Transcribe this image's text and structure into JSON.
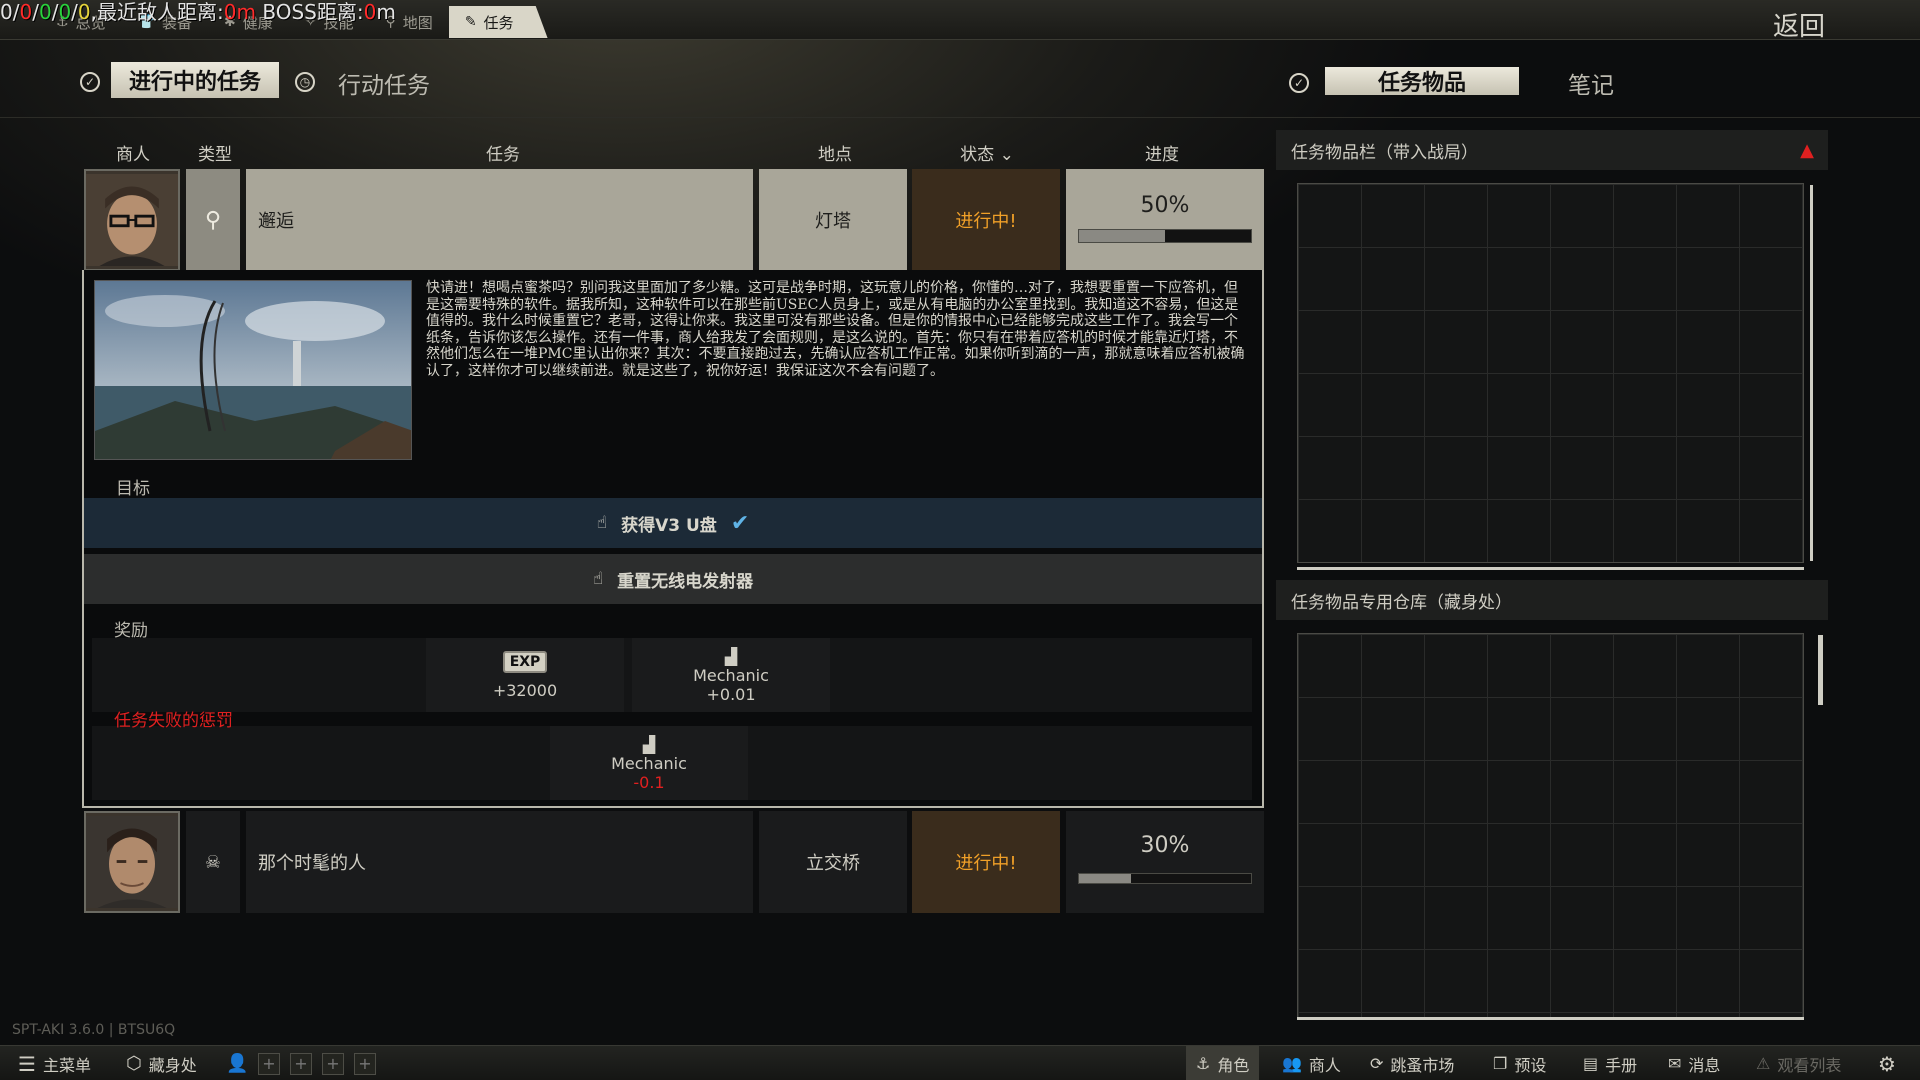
{
  "overlay": {
    "prefix": "0/",
    "n1": "0",
    "sep1": "/",
    "n2": "0",
    "sep2": "/",
    "n3": "0",
    "sep3": "/",
    "n4": "0",
    "label_nearest": ",最近敌人距离:",
    "nearest_value": "0m",
    "label_boss": " BOSS距离:",
    "boss_value": "0",
    "boss_unit": "m"
  },
  "toptabs": [
    {
      "label": "总览",
      "icon": "anchor-icon"
    },
    {
      "label": "装备",
      "icon": "gear-shirt-icon"
    },
    {
      "label": "健康",
      "icon": "health-icon"
    },
    {
      "label": "技能",
      "icon": "skills-icon"
    },
    {
      "label": "地图",
      "icon": "map-pin-icon"
    },
    {
      "label": "任务",
      "icon": "edit-icon"
    }
  ],
  "back_label": "返回",
  "subheader": {
    "active_quests": "进行中的任务",
    "operation_quests": "行动任务",
    "quest_items": "任务物品",
    "notes": "笔记"
  },
  "columns": {
    "trader": "商人",
    "type": "类型",
    "quest": "任务",
    "location": "地点",
    "status": "状态",
    "status_arrow": "⌄",
    "progress": "进度"
  },
  "quests": [
    {
      "name": "邂逅",
      "location": "灯塔",
      "status": "进行中!",
      "progress_text": "50%",
      "progress": 0.5,
      "type_icon": "search-icon"
    },
    {
      "name": "那个时髦的人",
      "location": "立交桥",
      "status": "进行中!",
      "progress_text": "30%",
      "progress": 0.3,
      "type_icon": "skull-icon"
    }
  ],
  "description": "快请进！想喝点蜜茶吗？别问我这里面加了多少糖。这可是战争时期，这玩意儿的价格，你懂的…对了，我想要重置一下应答机，但是这需要特殊的软件。据我所知，这种软件可以在那些前USEC人员身上，或是从有电脑的办公室里找到。我知道这不容易，但这是值得的。我什么时候重置它？老哥，这得让你来。我这里可没有那些设备。但是你的情报中心已经能够完成这些工作了。我会写一个纸条，告诉你该怎么操作。还有一件事，商人给我发了会面规则，是这么说的。首先：你只有在带着应答机的时候才能靠近灯塔，不然他们怎么在一堆PMC里认出你来？其次：不要直接跑过去，先确认应答机工作正常。如果你听到滴的一声，那就意味着应答机被确认了，这样你才可以继续前进。就是这些了，祝你好运！我保证这次不会有问题了。",
  "objectives_label": "目标",
  "objectives": [
    {
      "text": "获得V3 U盘",
      "done": true
    },
    {
      "text": "重置无线电发射器",
      "done": false
    }
  ],
  "rewards_label": "奖励",
  "rewards": {
    "exp_badge": "EXP",
    "exp_value": "+32000",
    "skill_name": "Mechanic",
    "skill_value": "+0.01"
  },
  "penalty_label": "任务失败的惩罚",
  "penalty": {
    "skill_name": "Mechanic",
    "skill_value": "-0.1"
  },
  "right": {
    "stash_title": "任务物品栏（带入战局）",
    "hideout_title": "任务物品专用仓库（藏身处）"
  },
  "version": "SPT-AKI 3.6.0 | BTSU6Q",
  "footer": {
    "main_menu": "主菜单",
    "hideout": "藏身处",
    "character": "角色",
    "traders": "商人",
    "flea": "跳蚤市场",
    "presets": "预设",
    "handbook": "手册",
    "messages": "消息",
    "watchlist": "观看列表",
    "plus": "+"
  },
  "colors": {
    "status_bg": "#3a2c1c",
    "status_text": "#f0a028",
    "penalty": "#e02020",
    "check": "#5fb3e6"
  }
}
